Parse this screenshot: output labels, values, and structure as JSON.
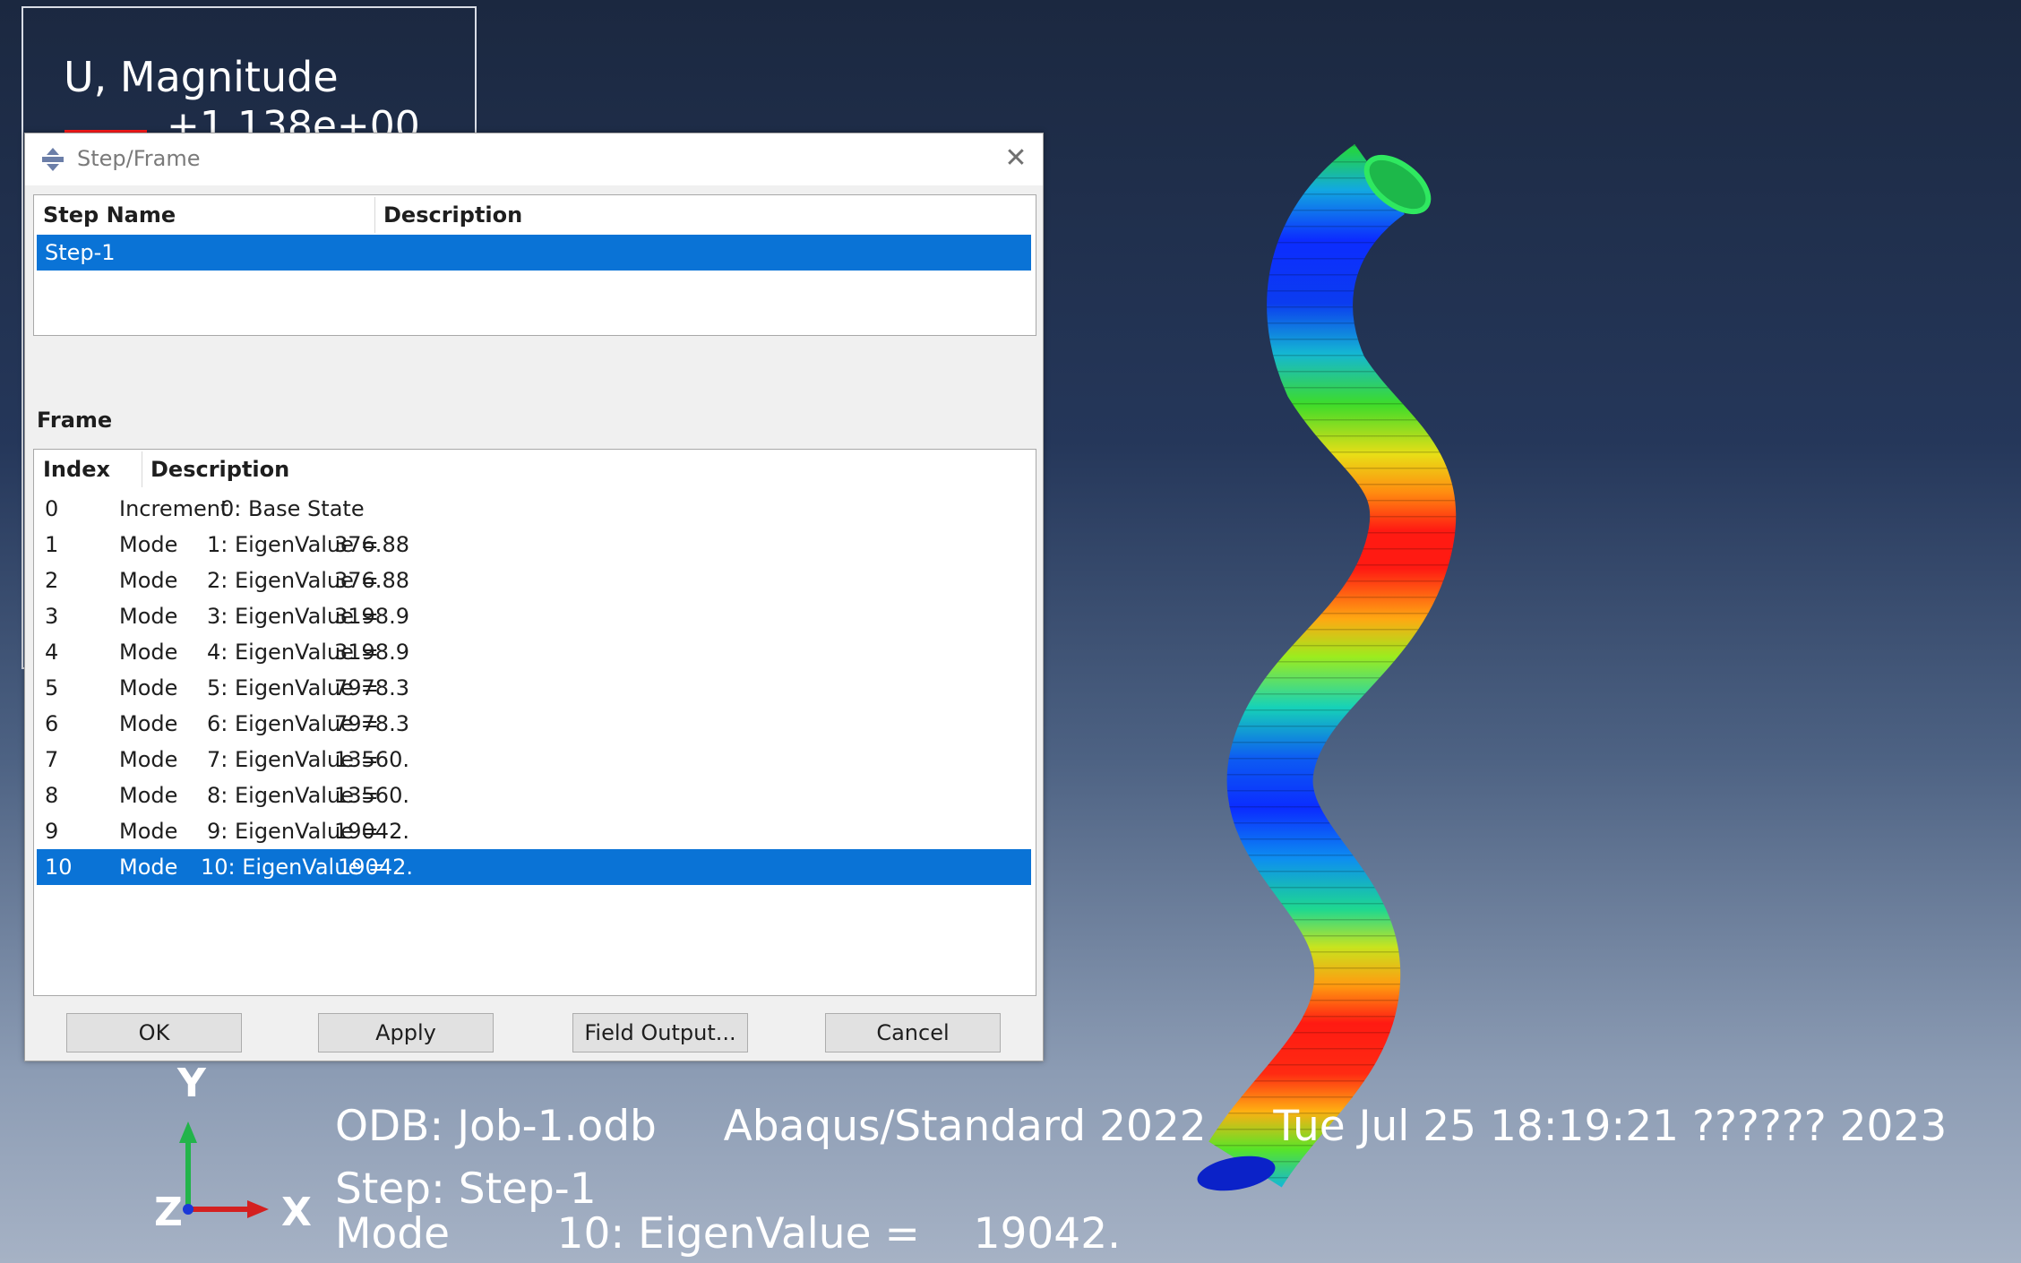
{
  "viewport": {
    "legend_title": "U, Magnitude",
    "legend_max": "+1.138e+00",
    "odb_line": "ODB: Job-1.odb     Abaqus/Standard 2022     Tue Jul 25 18:19:21 ?????? 2023",
    "step_line": "Step: Step-1",
    "mode_line": "Mode        10: EigenValue =    19042.",
    "triad": {
      "y": "Y",
      "z": "Z",
      "x": "X"
    }
  },
  "dialog": {
    "title": "Step/Frame",
    "step_list": {
      "headers": [
        "Step Name",
        "Description"
      ],
      "rows": [
        {
          "name": "Step-1",
          "description": "",
          "selected": true
        }
      ]
    },
    "frame_label": "Frame",
    "frame_list": {
      "headers": [
        "Index",
        "Description"
      ],
      "rows": [
        {
          "index": "0",
          "type": "Increment",
          "desc": "0: Base State"
        },
        {
          "index": "1",
          "type": "Mode",
          "desc": "1: EigenValue =",
          "value": "376.88"
        },
        {
          "index": "2",
          "type": "Mode",
          "desc": "2: EigenValue =",
          "value": "376.88"
        },
        {
          "index": "3",
          "type": "Mode",
          "desc": "3: EigenValue =",
          "value": "3198.9"
        },
        {
          "index": "4",
          "type": "Mode",
          "desc": "4: EigenValue =",
          "value": "3198.9"
        },
        {
          "index": "5",
          "type": "Mode",
          "desc": "5: EigenValue =",
          "value": "7978.3"
        },
        {
          "index": "6",
          "type": "Mode",
          "desc": "6: EigenValue =",
          "value": "7978.3"
        },
        {
          "index": "7",
          "type": "Mode",
          "desc": "7: EigenValue =",
          "value": "13560."
        },
        {
          "index": "8",
          "type": "Mode",
          "desc": "8: EigenValue =",
          "value": "13560."
        },
        {
          "index": "9",
          "type": "Mode",
          "desc": "9: EigenValue =",
          "value": "19042."
        },
        {
          "index": "10",
          "type": "Mode",
          "desc": "10: EigenValue =",
          "value": "19042.",
          "selected": true
        }
      ]
    },
    "buttons": {
      "ok": "OK",
      "apply": "Apply",
      "field_output": "Field Output...",
      "cancel": "Cancel"
    },
    "colors": {
      "selection": "#0a73d6"
    }
  }
}
